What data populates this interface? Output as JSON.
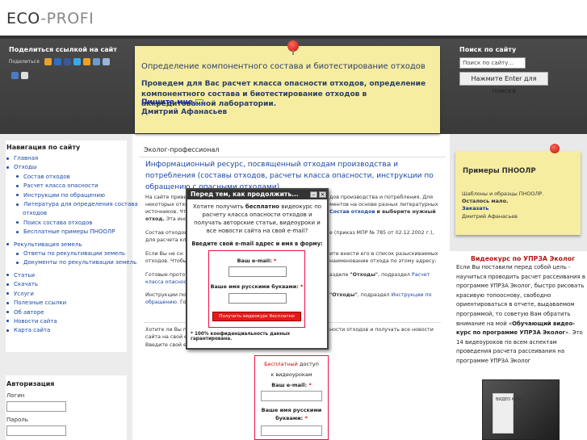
{
  "header": {
    "logo_part1": "ECO",
    "logo_part2": "-PROFI"
  },
  "share": {
    "title": "Поделиться ссылкой на сайт",
    "label": "Поделиться"
  },
  "promo": {
    "title": "Определение компонентного состава и биотестирование отходов",
    "text": "Проведем для Вас расчет класса опасности отходов, определение компонентного состава и биотестирование отходов в аккредитованной лаборатории.",
    "link": "Пишите мне",
    "author": "Дмитрий Афанасьев"
  },
  "search": {
    "title": "Поиск по сайту",
    "placeholder": "Поиск по сайту...",
    "button": "Нажмите Enter для поиска"
  },
  "nav": {
    "title": "Навигация по сайту",
    "items": [
      {
        "label": "Главная",
        "level": 0
      },
      {
        "label": "Отходы",
        "level": 0
      },
      {
        "label": "Состав отходов",
        "level": 1
      },
      {
        "label": "Расчет класса опасности",
        "level": 1
      },
      {
        "label": "Инструкции по обращению",
        "level": 1
      },
      {
        "label": "Литература для определения состава",
        "level": 1
      },
      {
        "label": "отходов",
        "level": 2
      },
      {
        "label": "Поиск состава отходов",
        "level": 1
      },
      {
        "label": "Бесплатные примеры ПНООЛР",
        "level": 1
      },
      {
        "label": "Рекультивация земель",
        "level": 0,
        "gap": true
      },
      {
        "label": "Ответы по рекультивации земель",
        "level": 1
      },
      {
        "label": "Документы по рекультивации земель",
        "level": 1
      },
      {
        "label": "Статьи",
        "level": 0,
        "gap": true
      },
      {
        "label": "Скачать",
        "level": 0
      },
      {
        "label": "Услуги",
        "level": 0
      },
      {
        "label": "Полезные ссылки",
        "level": 0
      },
      {
        "label": "Об авторе",
        "level": 0
      },
      {
        "label": "Новости сайта",
        "level": 0
      },
      {
        "label": "Карта сайта",
        "level": 0
      }
    ]
  },
  "auth": {
    "title": "Авторизация",
    "login_label": "Логин",
    "password_label": "Пароль"
  },
  "main": {
    "heading": "Эколог-профессионал",
    "lead": "Информационный ресурс, посвященный отходам производства и потребления (составы отходов, расчеты класса опасности, инструкции по обращению с опасными отходами).",
    "p1_start": "На сайте приве",
    "p1_end": "дов производства и потребления. Для",
    "p1b_start": "некоторых отхо",
    "p1b_end": "ментов на основе разных литературных",
    "p1c_start": "источников. Что",
    "p1c_link": "Состав отходов",
    "p1c_end": "и выберите нужный",
    "p1d_start": "отход.",
    "p1d_end": "Эта инф",
    "p2_start": "Состав отходов",
    "p2_end": "е (приказ МПР № 785 от 02.12.2002 г.),",
    "p2b": "для расчета кл",
    "p3_start": "Если Вы не сн",
    "p3_end": "ите внести его в список разыскиваемых",
    "p3b_start": "отходов. Чтобы",
    "p3b_end": "наименование отхода по этому адресу:",
    "p4_start": "Готовые прото",
    "p4_end": "азделе",
    "p4_link1": "\"Отходы\"",
    "p4_mid": ", подраздел",
    "p4_link2": "Расчет",
    "p4b": "класса опасност",
    "p5_start": "Инструкции по",
    "p5_end": "\"Отходы\"",
    "p5_mid": ", подраздел",
    "p5_link": "Инструкции по",
    "p5b_link": "обращению.",
    "p5b": "Го",
    "p6_start": "Хотите ли Вы п",
    "p6_end": "ности отходов и получать все новости",
    "p6b": "сайта на свой е",
    "p6c": "Введите свой е"
  },
  "lower_form": {
    "free_red": "Бесплатный",
    "free_rest": "доступ",
    "to_video": "к видеоурокам",
    "email_label": "Ваш e-mail:",
    "name_label_1": "Ваше имя русскими",
    "name_label_2": "буквами:"
  },
  "modal": {
    "title": "Перед тем, как продолжить...",
    "body_1": "Хотите получить",
    "body_bold": "бесплатно",
    "body_2": "видеокурс по расчету класса опасности отходов и получать авторские статьи, видеоуроки и все новости сайта на свой e-mail?",
    "ask": "Введите свой e-mail адрес и имя в форму:",
    "email_label": "Ваш e-mail:",
    "name_label": "Ваше имя русскими буквами:",
    "submit": "Получить видеокурс бесплатно",
    "footer": "100% конфиденциальность данных гарантирована."
  },
  "right": {
    "note_title": "Примеры ПНООЛР",
    "note_text_1": "Шаблоны и образцы ПНООЛР.",
    "note_text_2": "Осталось мало.",
    "note_link": "Заказать",
    "note_author": "Дмитрий Афанасьев",
    "video_title": "Видеокурс по УПРЗА Эколог",
    "video_text_1": "Если Вы поставили перед собой цель - научиться проводить расчет рассеивания в программе УПРЗА Эколог, быстро рисовать красивую топооснову, свободно ориентироваться в отчете, выдаваемом программой, то советую Вам обратить внимание на мой «",
    "video_text_bold": "Обучающий видео-курс по программе УПРЗА Эколог",
    "video_text_2": "». Это 14 видеоуроков по всем аспектам проведения расчета рассеивания на программе УПРЗА Эколог",
    "dvd_text": "ВИДЕО КУРС"
  },
  "colors": {
    "link": "#1b47a8",
    "note_yellow": "#f7eda0",
    "accent_red": "#e41a1a",
    "dark_band": "#404040"
  }
}
